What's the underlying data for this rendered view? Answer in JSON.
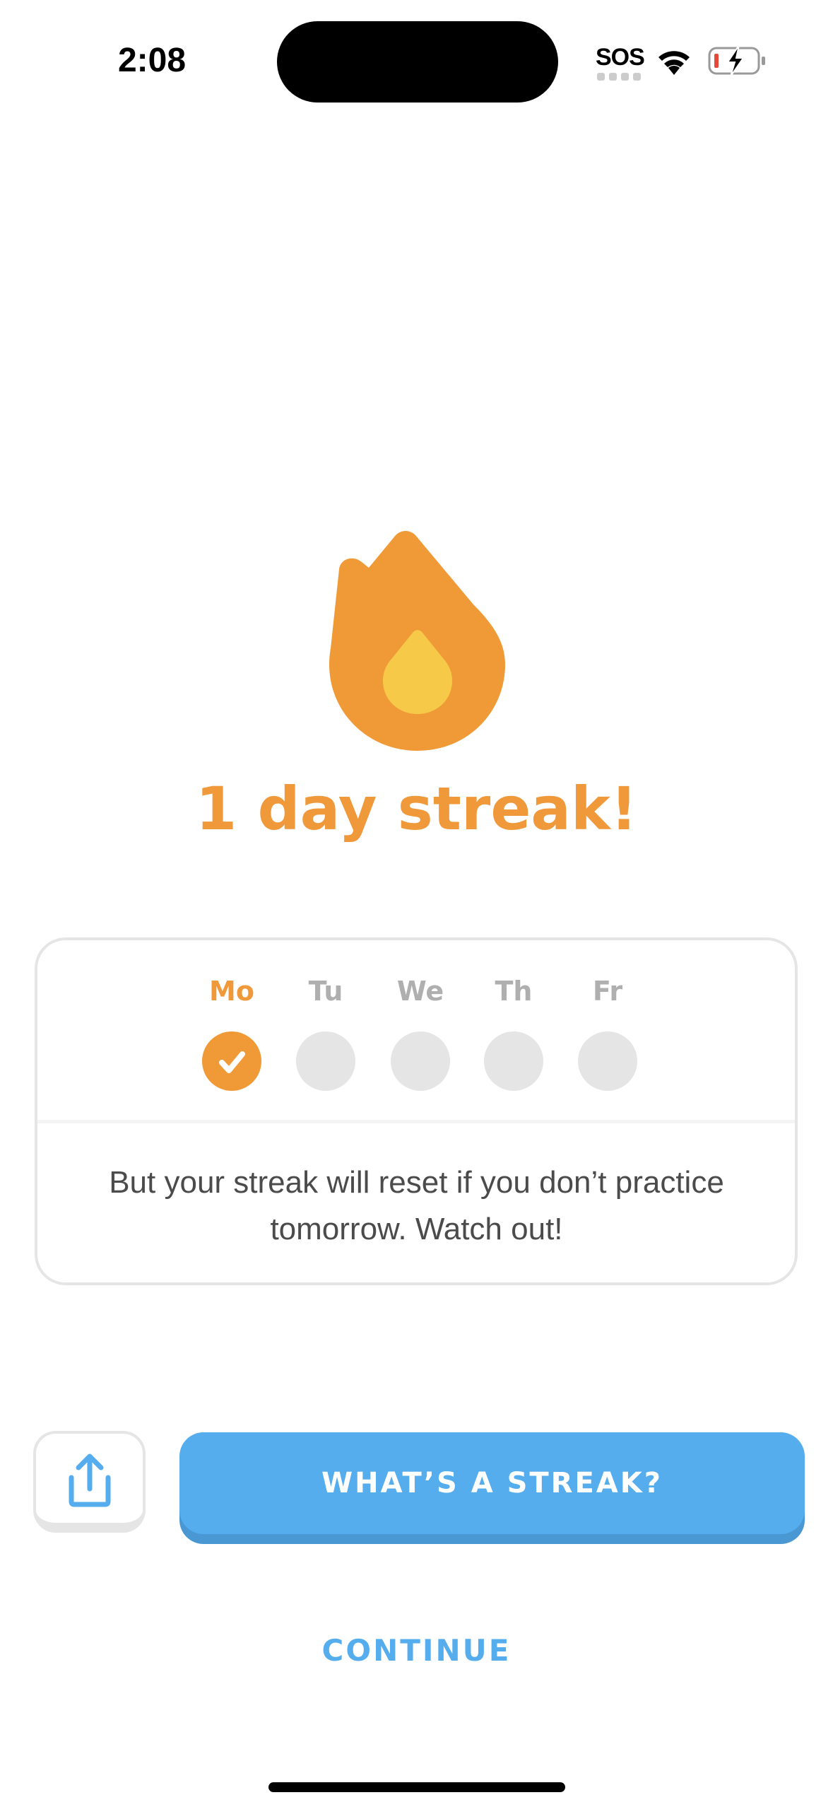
{
  "status_bar": {
    "time": "2:08",
    "carrier": "SOS",
    "wifi_icon": "wifi-icon",
    "battery_icon": "battery-charging-low-icon",
    "battery_level_color": "#E5493A"
  },
  "hero": {
    "icon": "flame-icon",
    "title": "1 day streak!",
    "colors": {
      "flame_outer": "#F09A37",
      "flame_inner": "#F7C948",
      "title": "#F0993A"
    }
  },
  "week": {
    "days": [
      {
        "label": "Mo",
        "done": true
      },
      {
        "label": "Tu",
        "done": false
      },
      {
        "label": "We",
        "done": false
      },
      {
        "label": "Th",
        "done": false
      },
      {
        "label": "Fr",
        "done": false
      }
    ],
    "message": "But your streak will reset if you don’t practice tomorrow. Watch out!"
  },
  "actions": {
    "share_icon": "share-icon",
    "primary_label": "WHAT’S A STREAK?",
    "continue_label": "CONTINUE",
    "accent": "#56ADEE"
  }
}
